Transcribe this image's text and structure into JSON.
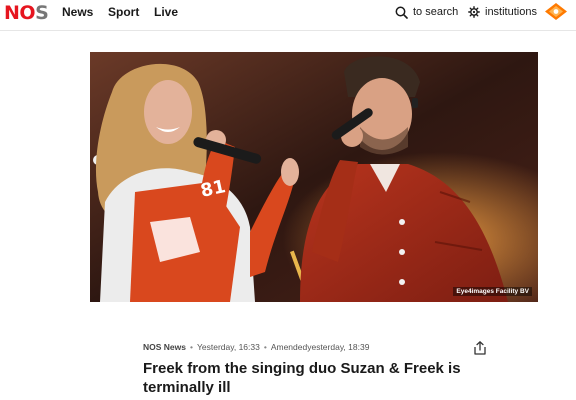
{
  "header": {
    "logo_main": "NO",
    "logo_dim": "S",
    "nav": [
      "News",
      "Sport",
      "Live"
    ],
    "search_label": "to search",
    "institutions_label": "institutions",
    "npo_logo_icon": "npo-logo-icon"
  },
  "hero": {
    "credit": "Eye4images Facility BV"
  },
  "article": {
    "source": "NOS News",
    "published": "Yesterday, 16:33",
    "amended": "Amendedyesterday, 18:39",
    "headline": "Freek from the singing duo Suzan & Freek is terminally ill",
    "share_icon": "share-icon"
  }
}
